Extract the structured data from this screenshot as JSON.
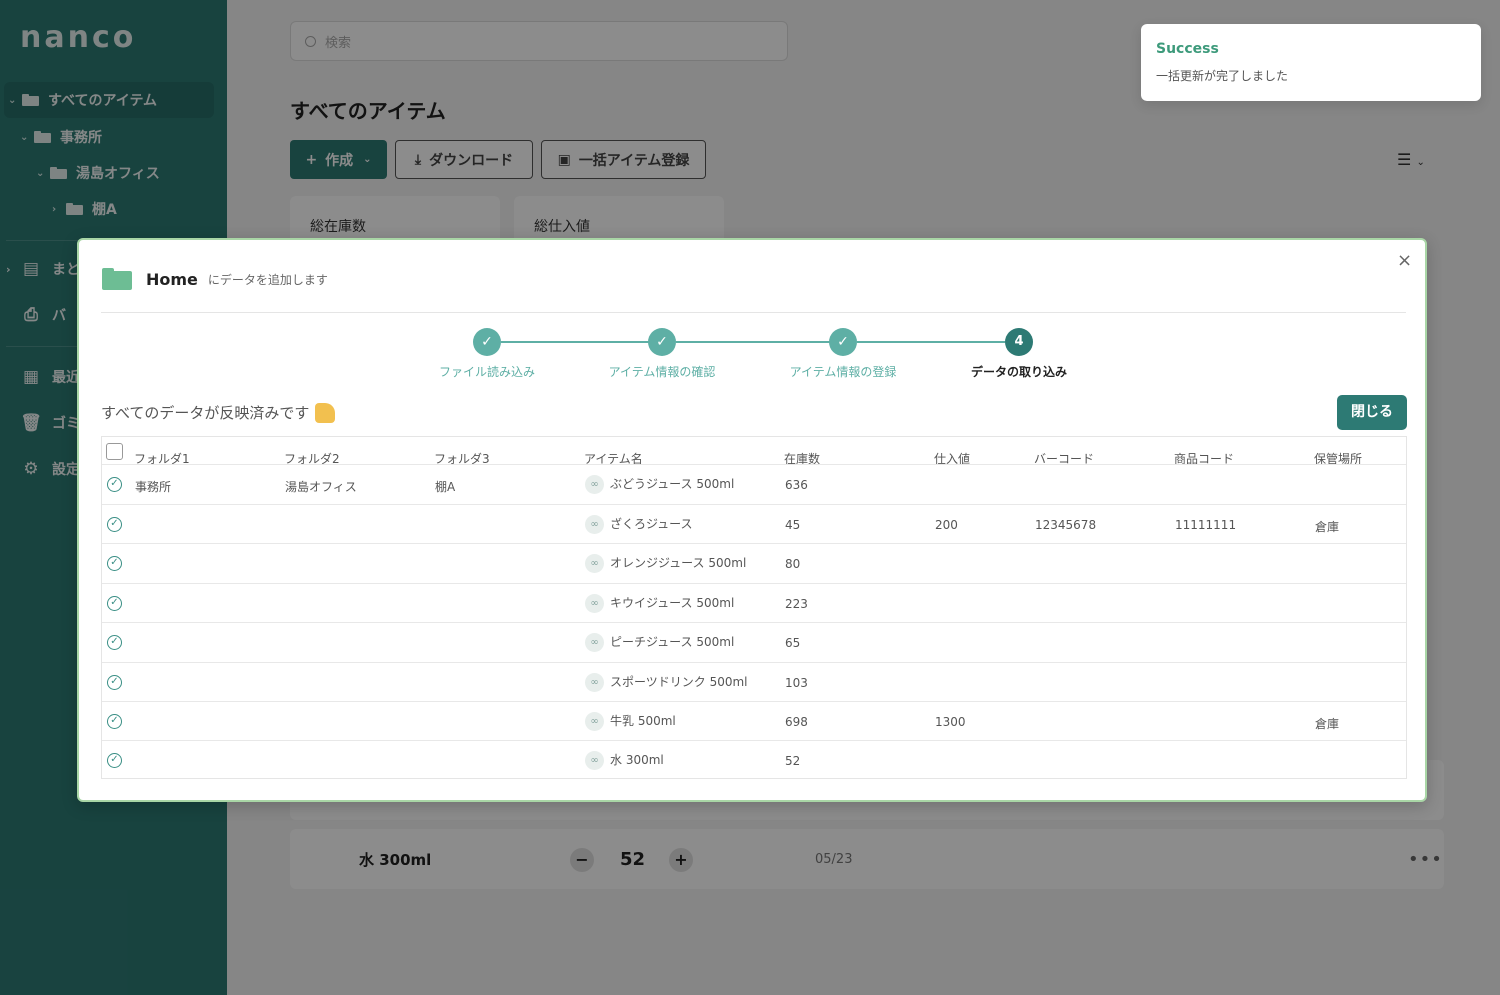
{
  "app": {
    "logo": "nanco"
  },
  "sidebar": {
    "tree": [
      {
        "label": "すべてのアイテム",
        "level": 0
      },
      {
        "label": "事務所",
        "level": 1
      },
      {
        "label": "湯島オフィス",
        "level": 2
      },
      {
        "label": "棚A",
        "level": 3
      }
    ],
    "nav": [
      {
        "label": "まと",
        "icon": "document-icon"
      },
      {
        "label": "バ",
        "icon": "printer-icon"
      },
      {
        "label": "最近",
        "icon": "recent-icon"
      },
      {
        "label": "ゴミ",
        "icon": "trash-icon"
      },
      {
        "label": "設定",
        "icon": "gear-icon"
      }
    ]
  },
  "main": {
    "search_placeholder": "検索",
    "title": "すべてのアイテム",
    "create_label": "作成",
    "download_label": "ダウンロード",
    "bulk_label": "一括アイテム登録",
    "stat_total_stock": "総在庫数",
    "stat_total_cost": "総仕入値",
    "last_row": {
      "name": "水 300ml",
      "qty": "52",
      "date": "05/23",
      "minus": "−",
      "plus": "+"
    }
  },
  "toast": {
    "title": "Success",
    "message": "一括更新が完了しました"
  },
  "modal": {
    "folder": "Home",
    "subtitle": "にデータを追加します",
    "steps": [
      {
        "label": "ファイル読み込み",
        "state": "done"
      },
      {
        "label": "アイテム情報の確認",
        "state": "done"
      },
      {
        "label": "アイテム情報の登録",
        "state": "done"
      },
      {
        "label": "データの取り込み",
        "state": "current",
        "number": "4"
      }
    ],
    "done_message": "すべてのデータが反映済みです",
    "close_label": "閉じる",
    "columns": [
      "フォルダ1",
      "フォルダ2",
      "フォルダ3",
      "アイテム名",
      "在庫数",
      "仕入値",
      "バーコード",
      "商品コード",
      "保管場所"
    ],
    "rows": [
      {
        "folder1": "事務所",
        "folder2": "湯島オフィス",
        "folder3": "棚A",
        "name": "ぶどうジュース 500ml",
        "stock": "636",
        "cost": "",
        "barcode": "",
        "code": "",
        "location": ""
      },
      {
        "folder1": "",
        "folder2": "",
        "folder3": "",
        "name": "ざくろジュース",
        "stock": "45",
        "cost": "200",
        "barcode": "12345678",
        "code": "11111111",
        "location": "倉庫"
      },
      {
        "folder1": "",
        "folder2": "",
        "folder3": "",
        "name": "オレンジジュース 500ml",
        "stock": "80",
        "cost": "",
        "barcode": "",
        "code": "",
        "location": ""
      },
      {
        "folder1": "",
        "folder2": "",
        "folder3": "",
        "name": "キウイジュース 500ml",
        "stock": "223",
        "cost": "",
        "barcode": "",
        "code": "",
        "location": ""
      },
      {
        "folder1": "",
        "folder2": "",
        "folder3": "",
        "name": "ピーチジュース 500ml",
        "stock": "65",
        "cost": "",
        "barcode": "",
        "code": "",
        "location": ""
      },
      {
        "folder1": "",
        "folder2": "",
        "folder3": "",
        "name": "スポーツドリンク 500ml",
        "stock": "103",
        "cost": "",
        "barcode": "",
        "code": "",
        "location": ""
      },
      {
        "folder1": "",
        "folder2": "",
        "folder3": "",
        "name": "牛乳 500ml",
        "stock": "698",
        "cost": "1300",
        "barcode": "",
        "code": "",
        "location": "倉庫"
      },
      {
        "folder1": "",
        "folder2": "",
        "folder3": "",
        "name": "水 300ml",
        "stock": "52",
        "cost": "",
        "barcode": "",
        "code": "",
        "location": ""
      }
    ]
  }
}
